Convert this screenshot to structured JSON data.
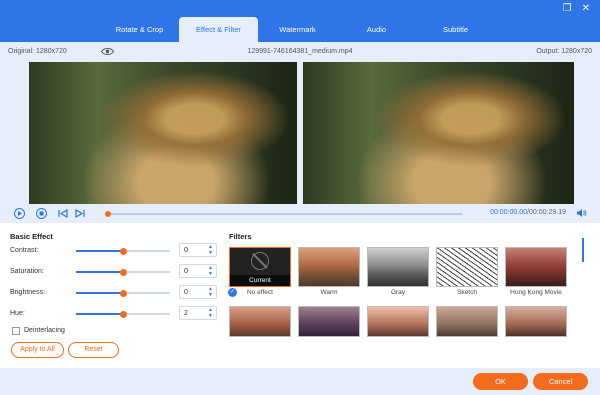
{
  "tabs": [
    "Rotate & Crop",
    "Effect & Filter",
    "Watermark",
    "Audio",
    "Subtitle"
  ],
  "active_tab": "Effect & Filter",
  "window_controls": {
    "restore": "❐",
    "close": "✕"
  },
  "info": {
    "original": "Original: 1280x720",
    "filename": "129991-746164381_medium.mp4",
    "output": "Output: 1280x720"
  },
  "player": {
    "current": "00:00:00.00",
    "separator": "/",
    "total": "00:00:29.19",
    "progress": 0.0
  },
  "basic_effect": {
    "title": "Basic Effect",
    "rows": [
      {
        "label": "Contrast:",
        "value": "0",
        "level": 0.5
      },
      {
        "label": "Saturation:",
        "value": "0",
        "level": 0.5
      },
      {
        "label": "Brightness:",
        "value": "0",
        "level": 0.5
      },
      {
        "label": "Hue:",
        "value": "2",
        "level": 0.5
      }
    ],
    "deinterlacing": "Deinterlacing",
    "apply_all": "Apply to All",
    "reset": "Reset"
  },
  "filters": {
    "title": "Filters",
    "current_label": "Current",
    "items": [
      "No effect",
      "Warm",
      "Gray",
      "Sketch",
      "Hong Kong Movie"
    ],
    "selected": "No effect"
  },
  "footer": {
    "ok": "OK",
    "cancel": "Cancel"
  },
  "colors": {
    "accent": "#2f75e8",
    "orange": "#f36b1c"
  }
}
